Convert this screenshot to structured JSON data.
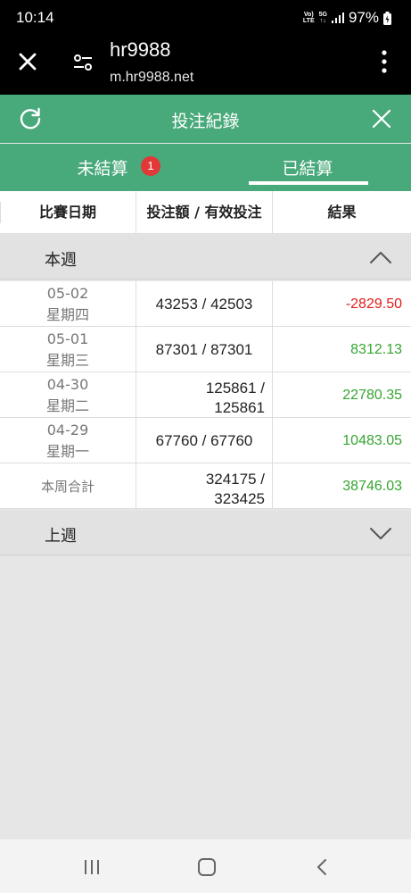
{
  "status": {
    "time": "10:14",
    "volte_top": "Vo)",
    "volte_bottom": "LTE",
    "net_top": "5G",
    "net_bottom": "↑↓",
    "battery": "97%"
  },
  "browser": {
    "title": "hr9988",
    "url": "m.hr9988.net"
  },
  "header": {
    "title": "投注紀錄"
  },
  "tabs": {
    "unsettled": "未結算",
    "unsettled_badge": "1",
    "settled": "已結算"
  },
  "columns": {
    "date": "比賽日期",
    "bet": "投注額 / 有效投注",
    "result": "結果"
  },
  "sections": {
    "this_week": "本週",
    "last_week": "上週"
  },
  "rows": [
    {
      "date": "05-02",
      "weekday": "星期四",
      "bet": "43253 / 42503",
      "result": "-2829.50"
    },
    {
      "date": "05-01",
      "weekday": "星期三",
      "bet": "87301 / 87301",
      "result": "8312.13"
    },
    {
      "date": "04-30",
      "weekday": "星期二",
      "bet_line1": "125861 /",
      "bet_line2": "125861",
      "result": "22780.35"
    },
    {
      "date": "04-29",
      "weekday": "星期一",
      "bet": "67760 / 67760",
      "result": "10483.05"
    }
  ],
  "total": {
    "label": "本周合計",
    "bet_line1": "324175 /",
    "bet_line2": "323425",
    "result": "38746.03"
  },
  "colors": {
    "header_green": "#48a97a",
    "negative": "#e11b1b",
    "positive": "#35a531",
    "badge": "#e23838"
  }
}
